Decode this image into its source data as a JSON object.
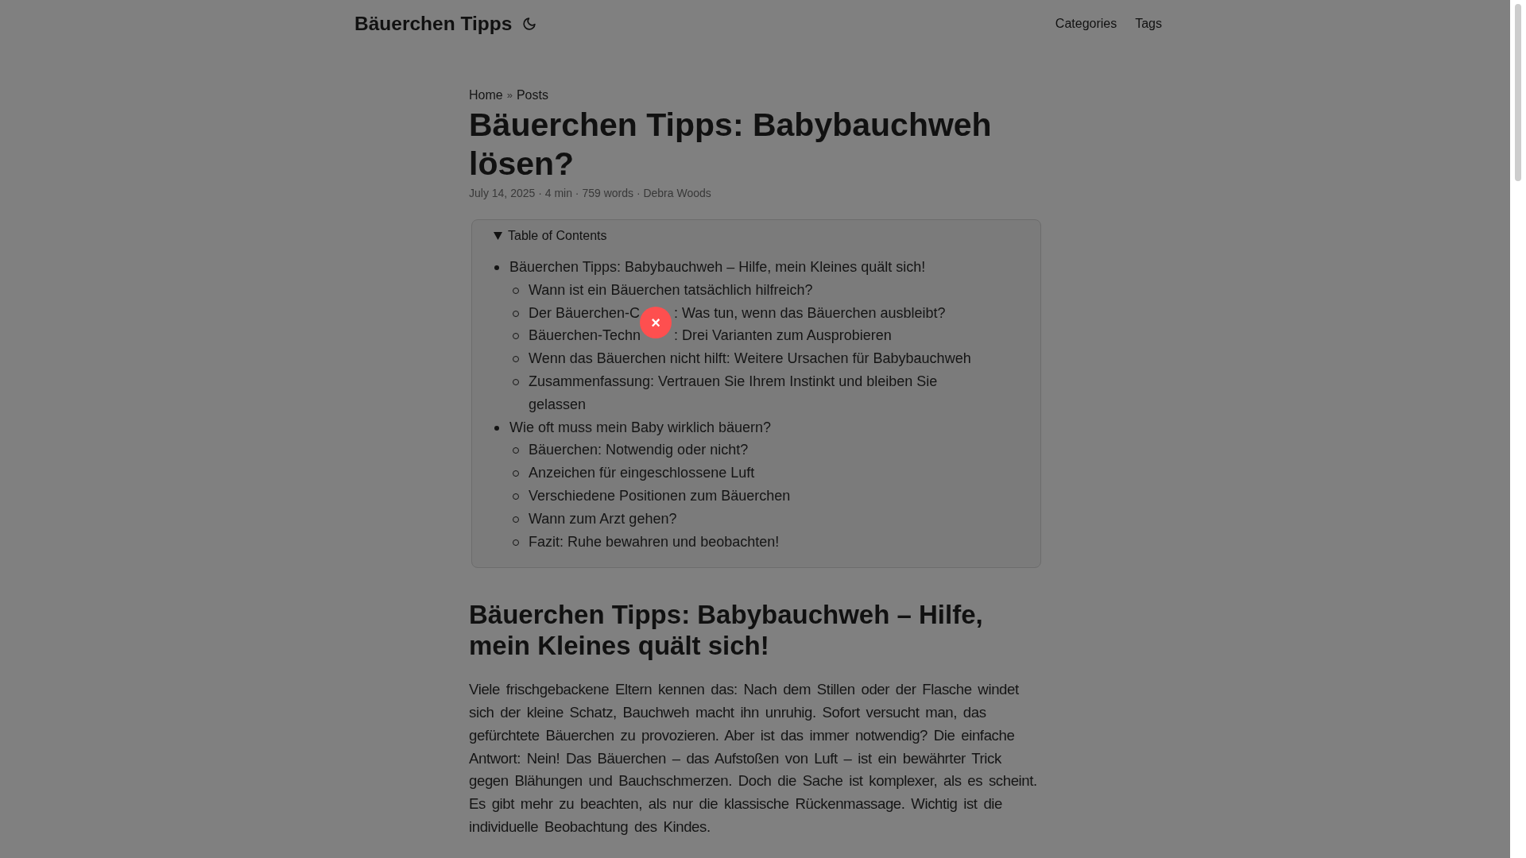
{
  "header": {
    "logo": "Bäuerchen Tipps",
    "menu": [
      {
        "label": "Categories"
      },
      {
        "label": "Tags"
      }
    ]
  },
  "breadcrumbs": {
    "items": [
      "Home",
      "Posts"
    ],
    "separator": "»"
  },
  "post": {
    "title": "Bäuerchen Tipps: Babybauchweh lösen?",
    "meta": "July 14, 2025 · 4 min · 759 words · Debra Woods"
  },
  "toc": {
    "summary": "Table of Contents",
    "expanded": true,
    "items": [
      {
        "label": "Bäuerchen Tipps: Babybauchweh – Hilfe, mein Kleines quält sich!",
        "children": [
          {
            "label": "Wann ist ein Bäuerchen tatsächlich hilfreich?"
          },
          {
            "label": "Der Bäuerchen-C",
            "label_rest": ": Was tun, wenn das Bäuerchen ausbleibt?"
          },
          {
            "label": "Bäuerchen-Techn",
            "label_rest": ": Drei Varianten zum Ausprobieren"
          },
          {
            "label": "Wenn das Bäuerchen nicht hilft: Weitere Ursachen für Babybauchweh"
          },
          {
            "label": "Zusammenfassung: Vertrauen Sie Ihrem Instinkt und bleiben Sie gelassen"
          }
        ]
      },
      {
        "label": "Wie oft muss mein Baby wirklich bäuern?",
        "children": [
          {
            "label": "Bäuerchen: Notwendig oder nicht?"
          },
          {
            "label": "Anzeichen für eingeschlossene Luft"
          },
          {
            "label": "Verschiedene Positionen zum Bäuerchen"
          },
          {
            "label": "Wann zum Arzt gehen?"
          },
          {
            "label": "Fazit: Ruhe bewahren und beobachten!"
          }
        ]
      }
    ]
  },
  "section": {
    "heading": "Bäuerchen Tipps: Babybauchweh – Hilfe, mein Kleines quält sich!",
    "paragraph": "Viele frischgebackene Eltern kennen das: Nach dem Stillen oder der Flasche windet sich der kleine Schatz, Bauchweh macht ihn unruhig. Sofort versucht man, das gefürchtete Bäuerchen zu provozieren. Aber ist das immer notwendig? Die einfache Antwort: Nein! Das Bäuerchen – das Aufstoßen von Luft – ist ein bewährter Trick gegen Blähungen und Bauchschmerzen. Doch die Sache ist komplexer, als es scheint. Es gibt mehr zu beachten, als nur die klassische Rückenmassage. Wichtig ist die individuelle Beobachtung des Kindes."
  },
  "close_button": {
    "label": "×"
  }
}
